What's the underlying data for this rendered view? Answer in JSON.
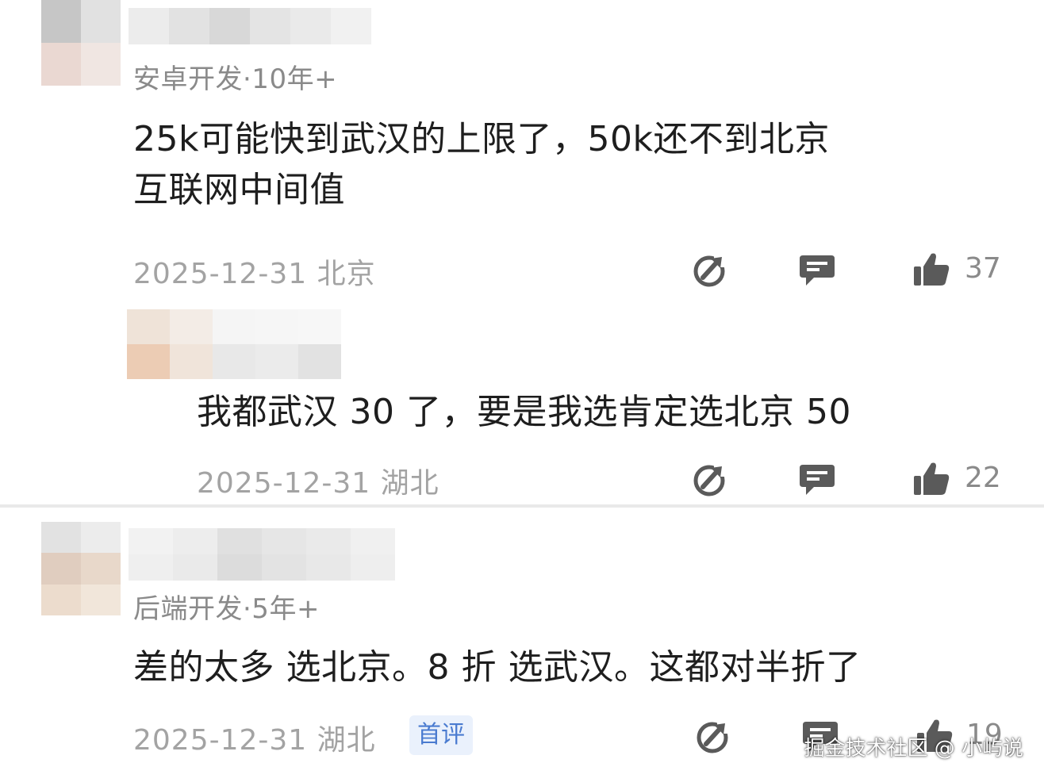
{
  "comments": [
    {
      "role": "安卓开发·10年+",
      "text_lines": [
        "25k可能快到武汉的上限了，50k还不到北京",
        "互联网中间值"
      ],
      "date_location": "2025-12-31 北京",
      "likes": "37"
    },
    {
      "text_lines": [
        "我都武汉 30 了，要是我选肯定选北京 50"
      ],
      "date_location": "2025-12-31 湖北",
      "likes": "22"
    },
    {
      "role": "后端开发·5年+",
      "text_lines": [
        "差的太多 选北京。8 折 选武汉。这都对半折了"
      ],
      "date_location": "2025-12-31 湖北",
      "badge": "首评",
      "likes": "19"
    }
  ],
  "icons": [
    "share-icon",
    "reply-icon",
    "like-icon"
  ],
  "watermark": "掘金技术社区 @ 小屿说",
  "colors": {
    "meta": "#8a8a8a",
    "date": "#a3a3a3",
    "icon": "#5a5a5a",
    "badge_bg": "#eaf1fc",
    "badge_text": "#4a7bd0"
  }
}
